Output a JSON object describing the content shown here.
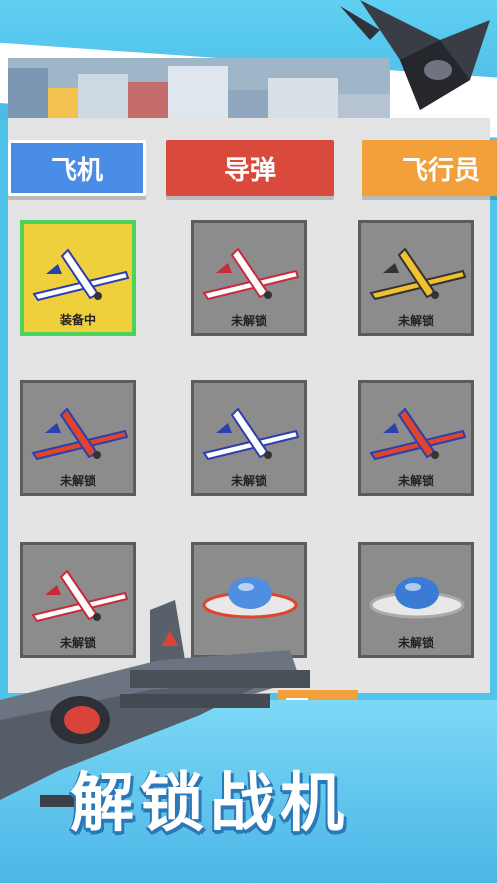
{
  "tabs": {
    "plane": "飞机",
    "missile": "导弹",
    "pilot": "飞行员"
  },
  "cards": [
    {
      "label": "装备中",
      "colors": {
        "body": "#ffffff",
        "accent": "#2a3fb0"
      }
    },
    {
      "label": "未解锁",
      "colors": {
        "body": "#ffffff",
        "accent": "#c92a3a"
      }
    },
    {
      "label": "未解锁",
      "colors": {
        "body": "#f2c12e",
        "accent": "#333"
      }
    },
    {
      "label": "未解锁",
      "colors": {
        "body": "#e0452c",
        "accent": "#2a3fb0"
      }
    },
    {
      "label": "未解锁",
      "colors": {
        "body": "#ffffff",
        "accent": "#2a3fb0"
      }
    },
    {
      "label": "未解锁",
      "colors": {
        "body": "#e0452c",
        "accent": "#2a3fb0"
      }
    },
    {
      "label": "未解锁",
      "colors": {
        "body": "#ffffff",
        "accent": "#c92a3a"
      }
    },
    {
      "label": "",
      "colors": {
        "body": "#4e8fe0",
        "accent": "#e0452c"
      }
    },
    {
      "label": "未解锁",
      "colors": {
        "body": "#3a7bd5",
        "accent": "#aaa"
      }
    }
  ],
  "slogan": "解锁战机",
  "colors": {
    "tab_plane": "#4a8de6",
    "tab_missile": "#d94a3c",
    "tab_pilot": "#f2a03b",
    "equipped_border": "#4bd25a",
    "equipped_bg": "#f0cf3c",
    "locked_bg": "#8c8c8c"
  }
}
